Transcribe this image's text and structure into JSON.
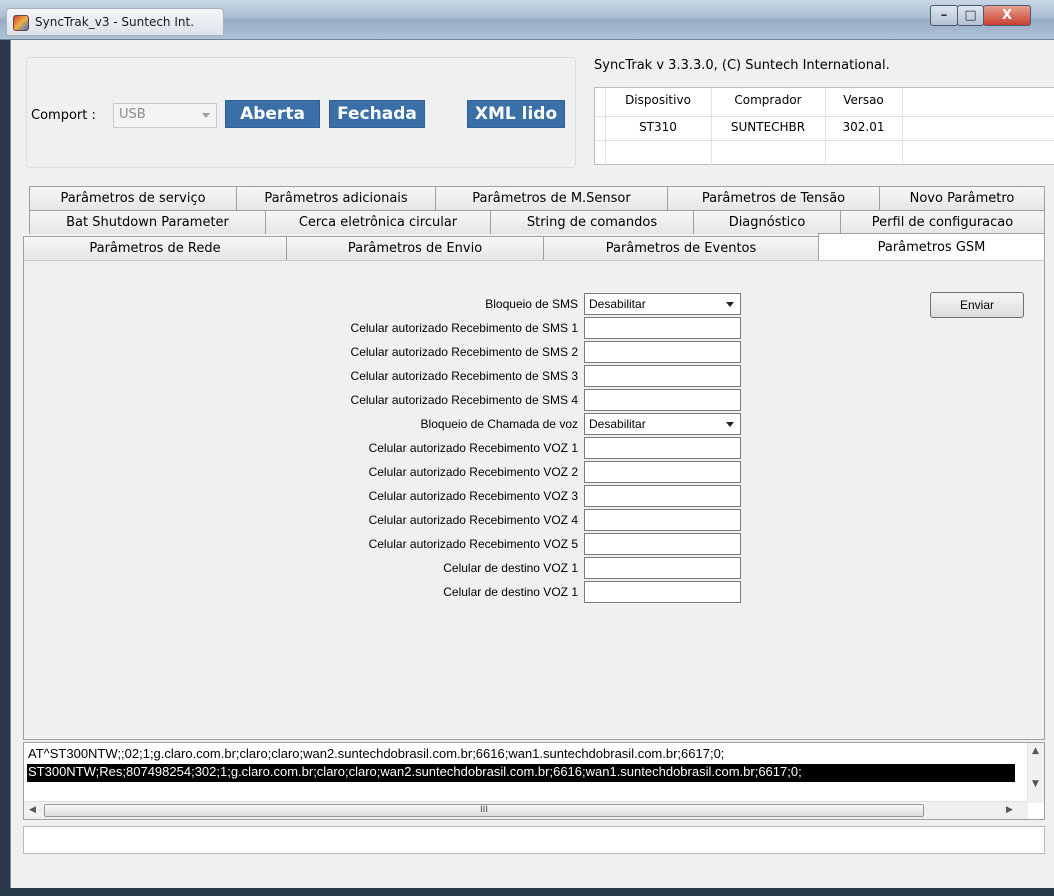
{
  "window": {
    "title": "SyncTrak_v3 - Suntech Int.",
    "controls": {
      "minimize": "–",
      "maximize": "□",
      "close": "X"
    }
  },
  "connection": {
    "comport_label": "Comport :",
    "comport_value": "USB",
    "open_button": "Aberta",
    "close_button": "Fechada",
    "xml_button": "XML lido"
  },
  "version_text": "SyncTrak v 3.3.3.0, (C) Suntech International.",
  "device_table": {
    "headers": [
      "Dispositivo",
      "Comprador",
      "Versao"
    ],
    "rows": [
      [
        "ST310",
        "SUNTECHBR",
        "302.01"
      ]
    ]
  },
  "tabs": {
    "row1": [
      "Parâmetros de serviço",
      "Parâmetros adicionais",
      "Parâmetros  de M.Sensor",
      "Parâmetros de Tensão",
      "Novo Parâmetro"
    ],
    "row2": [
      "Bat Shutdown Parameter",
      "Cerca eletrônica circular",
      "String de comandos",
      "Diagnóstico",
      "Perfil de configuracao"
    ],
    "row3": [
      "Parâmetros de Rede",
      "Parâmetros de Envio",
      "Parâmetros de Eventos",
      "Parâmetros GSM"
    ],
    "active": "Parâmetros GSM"
  },
  "gsm_form": {
    "sms_block_label": "Bloqueio de SMS",
    "sms_block_value": "Desabilitar",
    "sms_receivers": [
      "Celular autorizado Recebimento de SMS 1",
      "Celular autorizado Recebimento de SMS 2",
      "Celular autorizado Recebimento de SMS 3",
      "Celular autorizado Recebimento de SMS 4"
    ],
    "voice_block_label": "Bloqueio de Chamada de voz",
    "voice_block_value": "Desabilitar",
    "voice_receivers": [
      "Celular autorizado Recebimento VOZ 1",
      "Celular autorizado Recebimento VOZ 2",
      "Celular autorizado Recebimento VOZ 3",
      "Celular autorizado Recebimento VOZ 4",
      "Celular autorizado Recebimento VOZ 5"
    ],
    "voice_destinations": [
      "Celular de destino VOZ 1",
      "Celular de destino VOZ 1"
    ],
    "send_button": "Enviar"
  },
  "log": {
    "lines": [
      "AT^ST300NTW;;02;1;g.claro.com.br;claro;claro;wan2.suntechdobrasil.com.br;6616;wan1.suntechdobrasil.com.br;6617;0;",
      "ST300NTW;Res;807498254;302;1;g.claro.com.br;claro;claro;wan2.suntechdobrasil.com.br;6616;wan1.suntechdobrasil.com.br;6617;0;"
    ],
    "selected_line": 1,
    "scroll_thumb_grip": "III"
  },
  "status_text": ""
}
